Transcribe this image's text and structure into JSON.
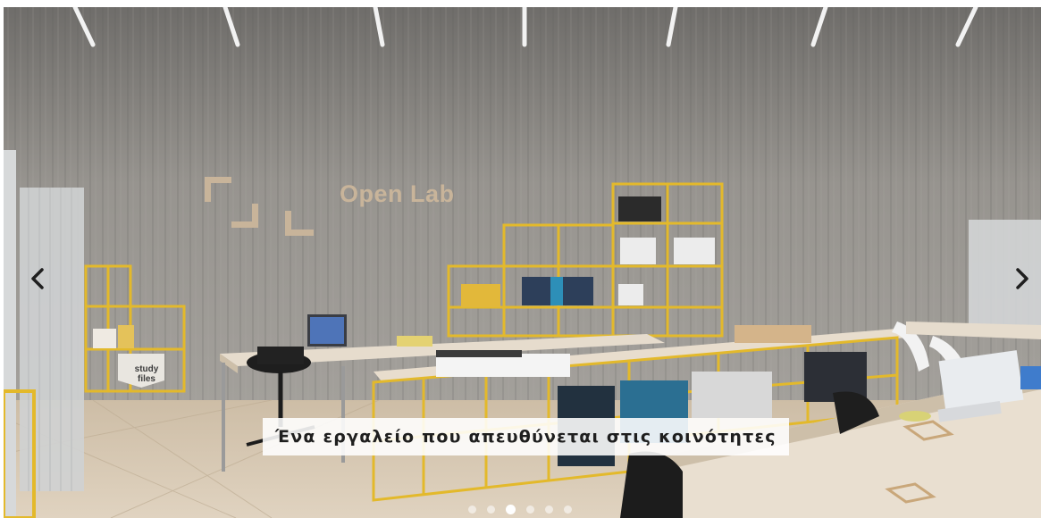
{
  "slider": {
    "caption": "Ένα εργαλείο που απευθύνεται στις κοινότητες",
    "prev_icon": "chevron-left-icon",
    "next_icon": "chevron-right-icon",
    "active_index": 2,
    "slide_count": 6
  },
  "scene": {
    "wall_sign": "Open Lab",
    "shelf_label_line1": "study",
    "shelf_label_line2": "files"
  },
  "colors": {
    "frame_yellow": "#e3b92b",
    "wall_grey": "#8e8c88",
    "desk_wood": "#ddd2c2"
  }
}
